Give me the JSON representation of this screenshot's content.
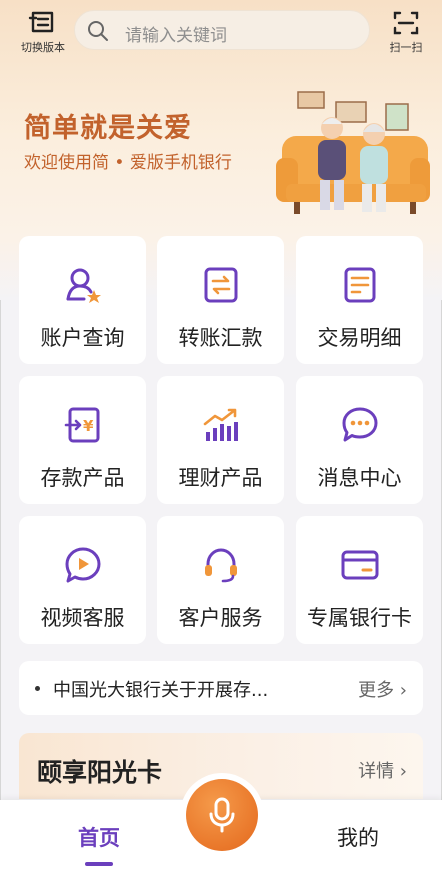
{
  "topbar": {
    "switch_label": "切换版本",
    "search_placeholder": "请输入关键词",
    "scan_label": "扫一扫"
  },
  "hero": {
    "slogan": "简单就是关爱",
    "subtitle": "欢迎使用简 • 爱版手机银行"
  },
  "grid": [
    {
      "label": "账户查询",
      "icon": "account-user-icon"
    },
    {
      "label": "转账汇款",
      "icon": "transfer-icon"
    },
    {
      "label": "交易明细",
      "icon": "transaction-details-icon"
    },
    {
      "label": "存款产品",
      "icon": "deposit-icon"
    },
    {
      "label": "理财产品",
      "icon": "wealth-chart-icon"
    },
    {
      "label": "消息中心",
      "icon": "message-bubble-icon"
    },
    {
      "label": "视频客服",
      "icon": "video-service-icon"
    },
    {
      "label": "客户服务",
      "icon": "headset-icon"
    },
    {
      "label": "专属银行卡",
      "icon": "bank-card-icon"
    }
  ],
  "notice": {
    "text": "中国光大银行关于开展存...",
    "more": "更多 ›"
  },
  "promo": {
    "title": "颐享阳光卡",
    "detail": "详情 ›"
  },
  "tabbar": {
    "home": "首页",
    "mine": "我的"
  },
  "colors": {
    "accent_purple": "#6b3fbd",
    "orange": "#e9772a",
    "slogan": "#c2622c"
  }
}
